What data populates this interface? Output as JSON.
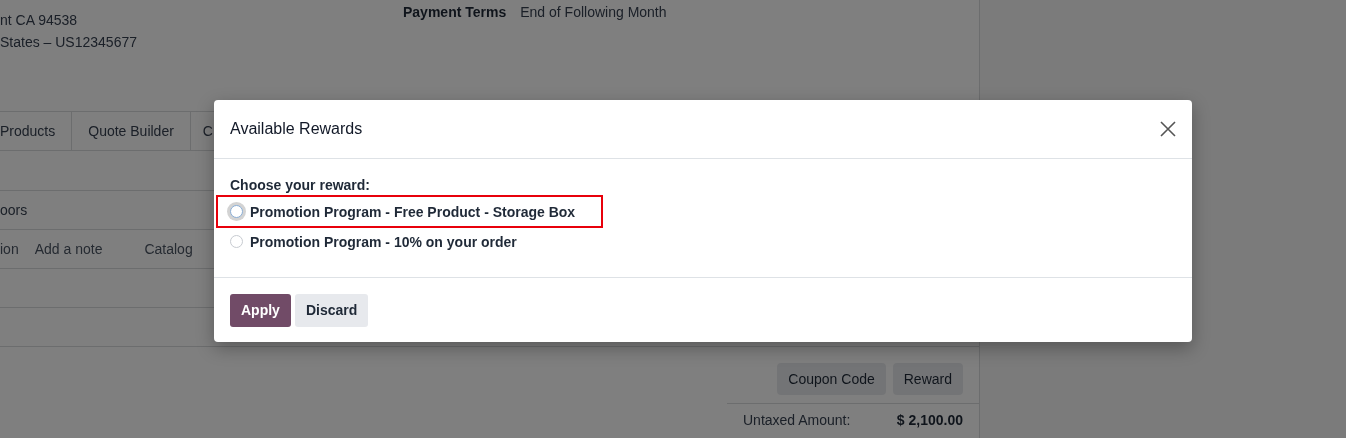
{
  "form": {
    "address_lines": [
      "nt CA 94538",
      "States – US12345677"
    ],
    "payment_terms": {
      "label": "Payment Terms",
      "value": "End of Following Month"
    },
    "tabs": [
      {
        "label": "Products",
        "selected": false
      },
      {
        "label": "Quote Builder",
        "selected": false
      },
      {
        "label": "C",
        "selected": false
      }
    ],
    "section_line": "oors",
    "line_actions": [
      "ion",
      "Add a note",
      "Catalog"
    ],
    "buttons": [
      "Coupon Code",
      "Reward"
    ],
    "totals": [
      {
        "label": "Untaxed Amount:",
        "value": "$ 2,100.00"
      }
    ]
  },
  "dialog": {
    "title": "Available Rewards",
    "prompt": "Choose your reward:",
    "options": [
      {
        "label": "Promotion Program - Free Product - Storage Box",
        "selected": false,
        "focused": true,
        "highlighted": true
      },
      {
        "label": "Promotion Program - 10% on your order",
        "selected": false,
        "focused": false,
        "highlighted": false
      }
    ],
    "buttons": [
      {
        "label": "Apply",
        "kind": "primary"
      },
      {
        "label": "Discard",
        "kind": "secondary"
      }
    ]
  }
}
